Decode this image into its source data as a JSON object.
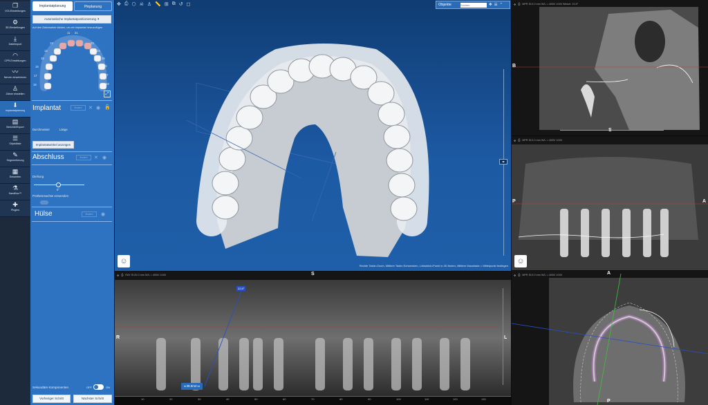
{
  "nav": [
    {
      "label": "VOI-Einstellungen",
      "icon": "❐",
      "name": "nav-voi"
    },
    {
      "label": "3D-Einstellungen",
      "icon": "⚙",
      "name": "nav-3d"
    },
    {
      "label": "Dateiimport",
      "icon": "⤓",
      "name": "nav-import"
    },
    {
      "label": "CPR-Einstellungen",
      "icon": "◠",
      "name": "nav-cpr"
    },
    {
      "label": "Nerven einzeichnen",
      "icon": "〰",
      "name": "nav-nerve"
    },
    {
      "label": "Zähne einstellen",
      "icon": "♙",
      "name": "nav-teeth"
    },
    {
      "label": "Implantatplanung",
      "icon": "⬇",
      "name": "nav-implant"
    },
    {
      "label": "Berichte/Export",
      "icon": "▤",
      "name": "nav-report"
    },
    {
      "label": "Objektliste",
      "icon": "☰",
      "name": "nav-objects"
    },
    {
      "label": "Segmentierung",
      "icon": "✎",
      "name": "nav-seg"
    },
    {
      "label": "Entwerfen",
      "icon": "▦",
      "name": "nav-design"
    },
    {
      "label": "SandBox™",
      "icon": "⚗",
      "name": "nav-sandbox"
    },
    {
      "label": "Plugins",
      "icon": "✚",
      "name": "nav-plugins"
    }
  ],
  "panel": {
    "tab_implant": "Implantatplanung",
    "tab_pin": "Pinplanung",
    "auto_btn": "Automatische Implantatpositionierung",
    "hint": "Auf den Zahnmarker klicken, um ein Implantat hinzuzufügen",
    "teeth_upper": [
      "11",
      "21",
      "13",
      "23",
      "14",
      "24",
      "15",
      "25",
      "16",
      "26",
      "17",
      "27",
      "18",
      "28"
    ],
    "implantat": {
      "title": "Implantat",
      "btn": "Ändern",
      "durchmesser": "Durchmesser",
      "laenge": "Länge",
      "angle_btn": "Implantatwinkel anzeigen"
    },
    "abschluss": {
      "title": "Abschluss",
      "btn": "Ändern",
      "drehung": "Drehung",
      "deg": "0°",
      "prothese": "Prothesenachse verwenden"
    },
    "huelse": {
      "title": "Hülse",
      "btn": "Ändern"
    },
    "sek": {
      "label": "Sekundäre Komponenten",
      "off": "OFF",
      "on": "ON"
    },
    "prev": "Vorheriger Schritt",
    "next": "Nächster Schritt"
  },
  "view3d": {
    "objects_label": "Objekte",
    "search_placeholder": "Suchen",
    "hint": "Rechte Taste=Zoom, Mittlere Taste=Schwenken, Linksklick=Punkt in 2D finden, Mittlere Maustaste = Mittelpunkt festlegen",
    "accent": "#1e5aa4"
  },
  "pano": {
    "toolbar": "RAY    Sl:20.0 mm    W/L = 4000/ 1000",
    "marker_top": "S",
    "left": "R",
    "right": "L",
    "angle": "22.5°",
    "measure": "38.6mm",
    "ticks": [
      "10",
      "20",
      "30",
      "40",
      "50",
      "60",
      "70",
      "80",
      "90",
      "100",
      "110",
      "120",
      "130"
    ]
  },
  "sag": {
    "toolbar": "MPR    Sl:0.0 mm    W/L = 4000/ 1000    Winkel: 22.5°",
    "left": "B",
    "bottom": "S"
  },
  "cor": {
    "toolbar": "MPR    Sl:0.0 mm    W/L = 4000/ 1000",
    "left": "P",
    "right": "A"
  },
  "axi": {
    "toolbar": "MPR    Sl:0.0 mm    W/L = 4000/ 1000",
    "top": "A",
    "bottom": "P"
  }
}
